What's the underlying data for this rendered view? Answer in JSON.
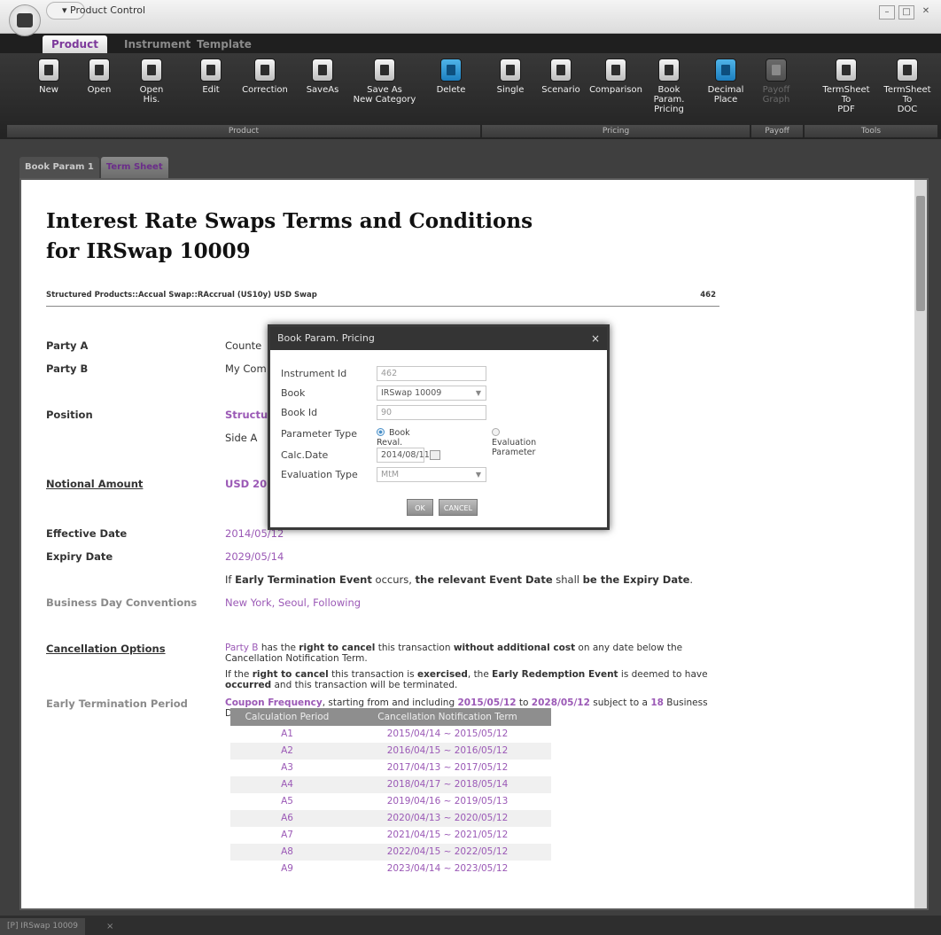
{
  "window": {
    "title": "Product Control"
  },
  "ribbon_tabs": [
    "Product",
    "Instrument",
    "Template"
  ],
  "ribbon": {
    "buttons": [
      {
        "label": "New"
      },
      {
        "label": "Open"
      },
      {
        "label": "Open\nHis."
      },
      {
        "label": "Edit"
      },
      {
        "label": "Correction"
      },
      {
        "label": "SaveAs"
      },
      {
        "label": "Save As\nNew Category"
      },
      {
        "label": "Delete"
      },
      {
        "label": "Single"
      },
      {
        "label": "Scenario"
      },
      {
        "label": "Comparison"
      },
      {
        "label": "Book Param.\nPricing"
      },
      {
        "label": "Decimal\nPlace"
      },
      {
        "label": "Payoff\nGraph"
      },
      {
        "label": "TermSheet To\nPDF"
      },
      {
        "label": "TermSheet To\nDOC"
      }
    ],
    "groups": [
      "Product",
      "Pricing",
      "Payoff",
      "Tools"
    ]
  },
  "doc_tabs": [
    "Book Param 1",
    "Term Sheet"
  ],
  "doc": {
    "title_line1": "Interest Rate Swaps Terms and Conditions",
    "title_line2": "for IRSwap 10009",
    "structure": "Structured Products::Accual Swap::RAccrual (US10y) USD Swap",
    "structure_id": "462",
    "party_a_label": "Party A",
    "party_a_value": "Counte",
    "party_b_label": "Party B",
    "party_b_value": "My Com",
    "position_label": "Position",
    "position_value": "Structu",
    "position_side": "Side A ",
    "notional_label": "Notional Amount",
    "notional_value": "USD 20",
    "effective_label": "Effective Date",
    "effective_value": "2014/05/12",
    "expiry_label": "Expiry Date",
    "expiry_value": "2029/05/14",
    "early_term_sentence": {
      "p1": "If ",
      "b1": "Early Termination Event",
      "p2": " occurs, ",
      "b2": "the relevant Event Date",
      "p3": " shall ",
      "b3": "be the Expiry Date",
      "p4": "."
    },
    "bdc_label": "Business Day Conventions",
    "bdc_value": "New York, Seoul, Following",
    "cancel_label": "Cancellation Options",
    "cancel_text1": {
      "pa": "Party B",
      "p1": " has the ",
      "b1": "right to cancel",
      "p2": " this transaction ",
      "b2": "without additional cost",
      "p3": " on any date below the Cancellation Notification Term."
    },
    "cancel_text2": {
      "p1": "If the ",
      "b1": "right to cancel",
      "p2": " this transaction is ",
      "b2": "exercised",
      "p3": ", the ",
      "b3": "Early Redemption Event",
      "p4": " is deemed to have ",
      "b4": "occurred",
      "p5": " and this transaction will be terminated."
    },
    "etp_label": "Early Termination Period",
    "etp_text": {
      "c1": "Coupon Frequency",
      "p1": ", starting from and including ",
      "c2": "2015/05/12",
      "p2": " to ",
      "c3": "2028/05/12",
      "p3": " subject to a ",
      "c4": "18",
      "p4": " Business Days Prior notification"
    },
    "table_headers": [
      "Calculation Period",
      "Cancellation Notification Term"
    ],
    "table_rows": [
      [
        "A1",
        "2015/04/14 ~ 2015/05/12"
      ],
      [
        "A2",
        "2016/04/15 ~ 2016/05/12"
      ],
      [
        "A3",
        "2017/04/13 ~ 2017/05/12"
      ],
      [
        "A4",
        "2018/04/17 ~ 2018/05/14"
      ],
      [
        "A5",
        "2019/04/16 ~ 2019/05/13"
      ],
      [
        "A6",
        "2020/04/13 ~ 2020/05/12"
      ],
      [
        "A7",
        "2021/04/15 ~ 2021/05/12"
      ],
      [
        "A8",
        "2022/04/15 ~ 2022/05/12"
      ],
      [
        "A9",
        "2023/04/14 ~ 2023/05/12"
      ]
    ]
  },
  "dialog": {
    "title": "Book Param. Pricing",
    "close": "×",
    "instrument_id_label": "Instrument Id",
    "instrument_id_value": "462",
    "book_label": "Book",
    "book_value": "IRSwap 10009",
    "book_id_label": "Book Id",
    "book_id_value": "90",
    "param_type_label": "Parameter Type",
    "param_opt1": "Book Reval. Parameter",
    "param_opt2": "Evaluation Parameter",
    "calc_date_label": "Calc.Date",
    "calc_date_value": "2014/08/11",
    "eval_type_label": "Evaluation Type",
    "eval_type_value": "MtM",
    "ok": "OK",
    "cancel": "CANCEL"
  },
  "bottom_tab": {
    "label": "[P] IRSwap 10009",
    "close": "×"
  },
  "colors": {
    "accent_purple": "#9b59b6",
    "tab_purple": "#7d3a9b"
  }
}
